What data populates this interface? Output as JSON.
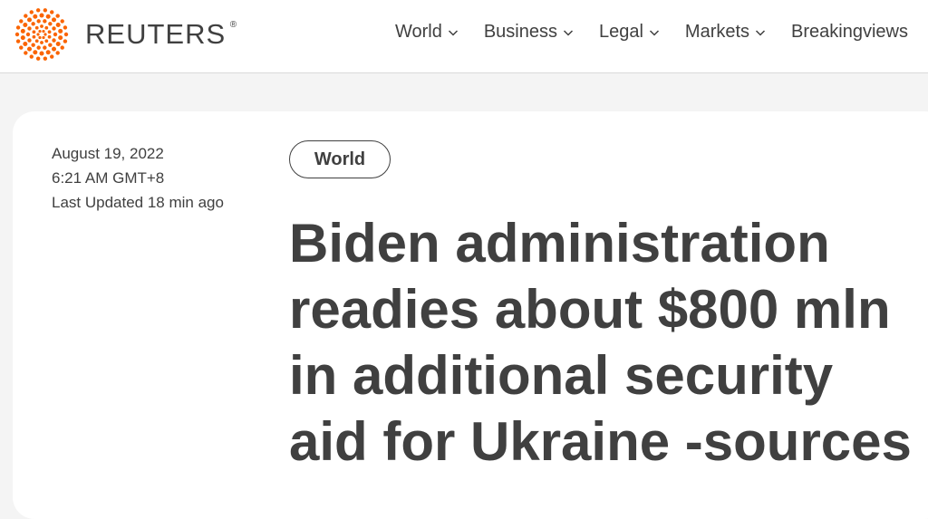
{
  "header": {
    "logo": {
      "text": "REUTERS",
      "registered_mark": "®",
      "icon": "reuters-dots-logo",
      "accent_color": "#fa6400"
    },
    "nav": [
      {
        "label": "World",
        "icon": "chevron-down-icon"
      },
      {
        "label": "Business",
        "icon": "chevron-down-icon"
      },
      {
        "label": "Legal",
        "icon": "chevron-down-icon"
      },
      {
        "label": "Markets",
        "icon": "chevron-down-icon"
      },
      {
        "label": "Breakingviews"
      }
    ]
  },
  "article": {
    "date": "August 19, 2022",
    "time": "6:21 AM GMT+8",
    "last_updated": "Last Updated 18 min ago",
    "section_tag": "World",
    "headline": "Biden administration readies about $800 mln in additional security aid for Ukraine -sources"
  },
  "colors": {
    "text": "#404040",
    "background": "#f4f4f4",
    "card": "#ffffff",
    "brand_orange": "#fa6400"
  }
}
